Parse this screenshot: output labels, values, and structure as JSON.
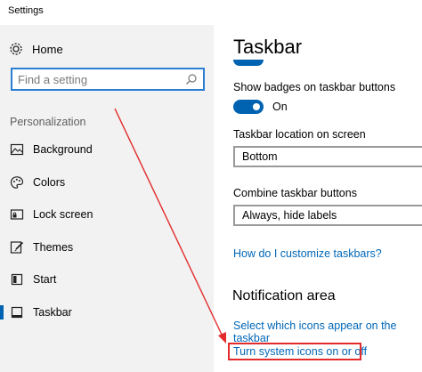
{
  "app": {
    "title": "Settings"
  },
  "sidebar": {
    "home_label": "Home",
    "search": {
      "placeholder": "Find a setting",
      "value": ""
    },
    "section_label": "Personalization",
    "items": [
      {
        "label": "Background",
        "icon": "picture-icon"
      },
      {
        "label": "Colors",
        "icon": "palette-icon"
      },
      {
        "label": "Lock screen",
        "icon": "lock-screen-icon"
      },
      {
        "label": "Themes",
        "icon": "brush-icon"
      },
      {
        "label": "Start",
        "icon": "start-icon"
      },
      {
        "label": "Taskbar",
        "icon": "taskbar-icon",
        "active": true
      }
    ]
  },
  "main": {
    "title": "Taskbar",
    "show_badges": {
      "label": "Show badges on taskbar buttons",
      "state_text": "On"
    },
    "location": {
      "label": "Taskbar location on screen",
      "value": "Bottom"
    },
    "combine": {
      "label": "Combine taskbar buttons",
      "value": "Always, hide labels"
    },
    "customize_link": "How do I customize taskbars?",
    "notification": {
      "heading": "Notification area",
      "link_select_icons": "Select which icons appear on the taskbar",
      "link_system_icons": "Turn system icons on or off"
    }
  },
  "colors": {
    "accent": "#0063b1",
    "link": "#0067b8",
    "annotation": "#e32b2b",
    "sidebar_bg": "#f2f2f2"
  }
}
